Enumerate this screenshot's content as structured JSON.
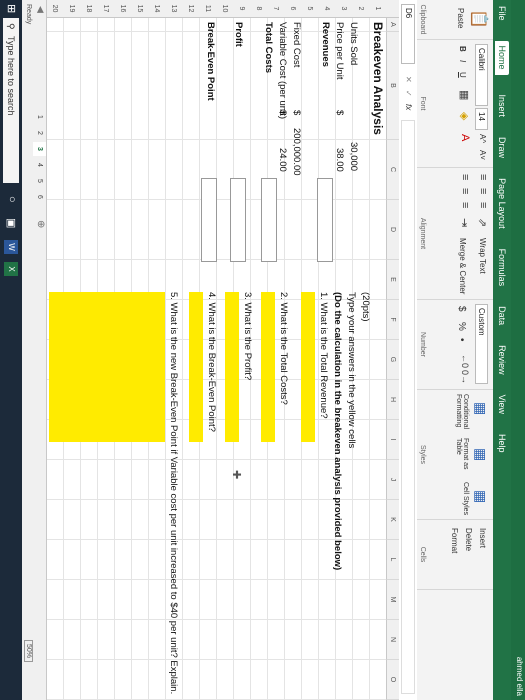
{
  "titlebar": {
    "alert": "ahmed ella"
  },
  "menu": [
    "File",
    "Home",
    "Insert",
    "Draw",
    "Page Layout",
    "Formulas",
    "Data",
    "Review",
    "View",
    "Help"
  ],
  "ribbon": {
    "paste": "Paste",
    "font_name": "Calibri",
    "font_size": "14",
    "font_grow": "A^",
    "font_shrink": "A˅",
    "bold": "B",
    "italic": "I",
    "underline": "U",
    "wrap_text": "Wrap Text",
    "merge_center": "Merge & Center",
    "number_format": "Custom",
    "currency": "$",
    "percent": "%",
    "comma": "•",
    "cond_format": "Conditional Formatting",
    "format_as_table": "Format as Table",
    "cell_styles": "Cell Styles",
    "insert": "Insert",
    "delete": "Delete",
    "format": "Format",
    "groups": {
      "clipboard": "Clipboard",
      "font": "Font",
      "alignment": "Alignment",
      "number": "Number",
      "styles": "Styles",
      "cells": "Cells"
    }
  },
  "formula_bar": {
    "name_box": "D6",
    "cancel": "✕",
    "enter": "✓",
    "fx": "fx",
    "content": ""
  },
  "columns": [
    "A",
    "B",
    "C",
    "D",
    "E",
    "F",
    "G",
    "H",
    "I",
    "J",
    "K",
    "L",
    "M",
    "N",
    "O"
  ],
  "rows": [
    "1",
    "2",
    "3",
    "4",
    "5",
    "6",
    "7",
    "8",
    "9",
    "10",
    "11",
    "12",
    "13",
    "14",
    "15",
    "16",
    "17",
    "18",
    "19",
    "20"
  ],
  "sheet": {
    "title": "Breakeven Analysis",
    "units_sold_label": "Units Sold",
    "units_sold_value": "30,000",
    "price_label": "Price per Unit",
    "price_currency": "$",
    "price_value": "38.00",
    "revenues_label": "Revenues",
    "fixed_cost_label": "Fixed Cost",
    "fixed_cost_currency": "$",
    "fixed_cost_value": "200,000.00",
    "variable_cost_label": "Variable Cost (per unit)",
    "variable_cost_currency": "$",
    "variable_cost_value": "24.00",
    "total_costs_label": "Total Costs",
    "profit_label": "Profit",
    "breakeven_label": "Break-Even Point",
    "points": "(20pts)",
    "instr1": "Type your answers in the yellow cells",
    "instr2": "(Do the calculation in the breakeven analysis provided below)",
    "q1": "1. What is the Total Revenue?",
    "q2": "2. What is the Total Costs?",
    "q3": "3. What is the Profit?",
    "q4": "4. What is the Break-Even Point?",
    "q5": "5. What is the new Break-Even Point if Variable cost per unit increased to $40 per unit? Explain."
  },
  "sheet_tabs": [
    "1",
    "2",
    "3",
    "4",
    "5",
    "6"
  ],
  "active_sheet_tab": "3",
  "status": {
    "ready": "Ready",
    "zoom": "50%"
  },
  "taskbar": {
    "search_placeholder": "Type here to search"
  },
  "colors": {
    "excel_green": "#217346",
    "answer_yellow": "#ffeb00"
  }
}
